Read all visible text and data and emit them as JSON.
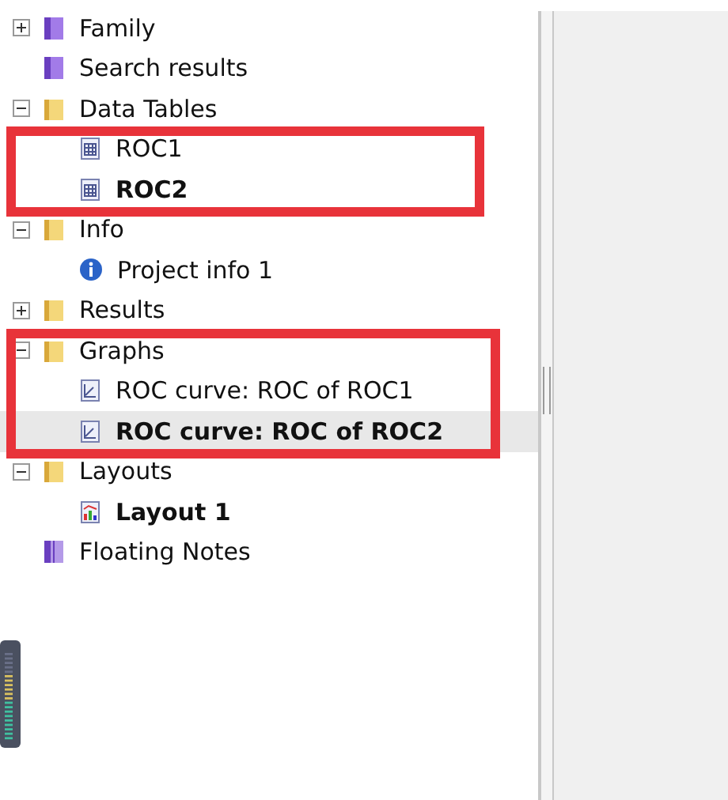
{
  "tree": [
    {
      "label": "Family",
      "kind": "book",
      "expanded": false,
      "selected": false,
      "bold": false
    },
    {
      "label": "Search results",
      "kind": "book",
      "selected": false,
      "bold": false
    },
    {
      "label": "Data Tables",
      "kind": "folder",
      "expanded": true,
      "selected": false,
      "bold": false,
      "children_framed": true,
      "children": [
        {
          "label": "ROC1",
          "kind": "table",
          "selected": false,
          "bold": false
        },
        {
          "label": "ROC2",
          "kind": "table",
          "selected": false,
          "bold": true
        }
      ]
    },
    {
      "label": "Info",
      "kind": "folder",
      "expanded": true,
      "selected": false,
      "bold": false,
      "children": [
        {
          "label": "Project info 1",
          "kind": "info",
          "selected": false,
          "bold": false
        }
      ]
    },
    {
      "label": "Results",
      "kind": "folder",
      "expanded": false,
      "selected": false,
      "bold": false
    },
    {
      "label": "Graphs",
      "kind": "folder",
      "expanded": true,
      "selected": false,
      "bold": false,
      "framed": true,
      "children": [
        {
          "label": "ROC curve: ROC of ROC1",
          "kind": "graph",
          "selected": false,
          "bold": false
        },
        {
          "label": "ROC curve: ROC of ROC2",
          "kind": "graph",
          "selected": true,
          "bold": true
        }
      ]
    },
    {
      "label": "Layouts",
      "kind": "folder",
      "expanded": true,
      "selected": false,
      "bold": false,
      "children": [
        {
          "label": "Layout 1",
          "kind": "layout",
          "selected": false,
          "bold": true
        }
      ]
    },
    {
      "label": "Floating Notes",
      "kind": "notes",
      "selected": false,
      "bold": false
    }
  ]
}
